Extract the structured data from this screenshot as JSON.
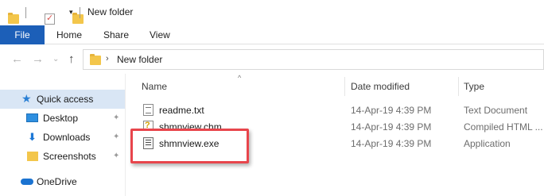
{
  "window": {
    "title": "New folder"
  },
  "ribbon": {
    "file_label": "File",
    "tabs": [
      "Home",
      "Share",
      "View"
    ]
  },
  "address": {
    "path": "New folder"
  },
  "nav": {
    "items": [
      {
        "label": "Quick access",
        "icon": "star-icon",
        "pinned": false
      },
      {
        "label": "Desktop",
        "icon": "desktop-icon",
        "pinned": true
      },
      {
        "label": "Downloads",
        "icon": "downloads-icon",
        "pinned": true
      },
      {
        "label": "Screenshots",
        "icon": "folder-icon",
        "pinned": true
      },
      {
        "label": "OneDrive",
        "icon": "onedrive-icon",
        "pinned": false
      }
    ]
  },
  "columns": [
    "Name",
    "Date modified",
    "Type"
  ],
  "files": [
    {
      "name": "readme.txt",
      "date": "14-Apr-19 4:39 PM",
      "type": "Text Document",
      "icon": "text-file-icon"
    },
    {
      "name": "shmnview.chm",
      "date": "14-Apr-19 4:39 PM",
      "type": "Compiled HTML ...",
      "icon": "help-file-icon"
    },
    {
      "name": "shmnview.exe",
      "date": "14-Apr-19 4:39 PM",
      "type": "Application",
      "icon": "exe-file-icon"
    }
  ],
  "highlight": {
    "label": "shmnview.exe",
    "color": "#e8454c"
  },
  "colors": {
    "accent": "#1c5fb8",
    "selected": "#d9e6f5"
  }
}
